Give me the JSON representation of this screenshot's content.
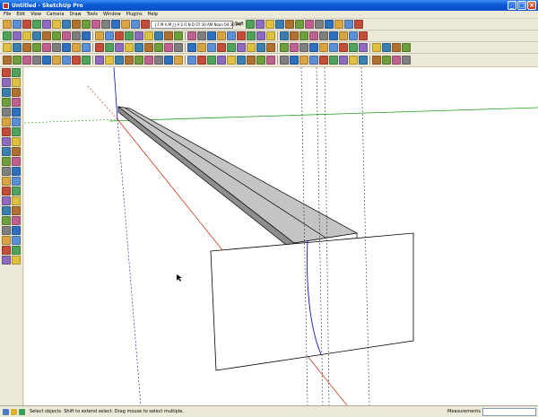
{
  "window": {
    "title": "Untitled - SketchUp Pro",
    "minimize": "_",
    "maximize": "□",
    "close": "×"
  },
  "menus": [
    "File",
    "Edit",
    "View",
    "Camera",
    "Draw",
    "Tools",
    "Window",
    "Plugins",
    "Help"
  ],
  "toolbar": {
    "shadow_time": "J F M A M J J A S O N D   07:30 AM   Noon   04:30 PM",
    "soft_label": "Soft"
  },
  "status": {
    "hint": "Select objects. Shift to extend select. Drag mouse to select multiple.",
    "measurements_label": "Measurements",
    "measurements_value": ""
  },
  "colors": {
    "red_axis": "#cc2200",
    "green_axis": "#18a018",
    "blue_axis": "#1010c0",
    "face_top": "#c4c4c4",
    "face_side": "#8e8e8e",
    "face_light": "#ffffff"
  },
  "icons": {
    "row1": [
      "new-icon",
      "open-icon",
      "save-icon",
      "print-icon",
      "cut-icon",
      "copy-icon",
      "paste-icon",
      "erase-icon",
      "undo-icon",
      "redo-icon",
      "select-icon",
      "eraser-icon",
      "paint-icon",
      "component-icon",
      "group-icon",
      "iso-view-icon",
      "top-view-icon",
      "front-view-icon",
      "right-view-icon",
      "back-view-icon",
      "left-view-icon",
      "x-ray-icon",
      "wireframe-icon",
      "hidden-line-icon",
      "shaded-icon",
      "shaded-texture-icon",
      "monochrome-icon"
    ],
    "row2": [
      "line-icon",
      "freehand-icon",
      "arc-icon",
      "rectangle-icon",
      "circle-icon",
      "polygon-icon",
      "pushpull-icon",
      "move-icon",
      "rotate-icon",
      "scale-icon",
      "followme-icon",
      "offset-icon",
      "tape-icon",
      "protractor-icon",
      "axes-icon",
      "dimension-icon",
      "text-icon",
      "3dtext-icon",
      "section-icon",
      "orbit-icon",
      "pan-icon",
      "zoom-icon",
      "zoom-window-icon",
      "zoom-extents-icon",
      "previous-icon",
      "walk-icon",
      "lookaround-icon",
      "position-camera-icon",
      "sandbox-icon",
      "smoove-icon",
      "stamp-icon",
      "drape-icon",
      "add-detail-icon",
      "flip-edge-icon",
      "layers-icon",
      "warehouse-icon"
    ],
    "row3": [
      "plugin-icon",
      "plugin-icon",
      "plugin-icon",
      "plugin-icon",
      "plugin-icon",
      "plugin-icon",
      "plugin-icon",
      "plugin-icon",
      "plugin-icon",
      "plugin-icon",
      "plugin-icon",
      "plugin-icon",
      "plugin-icon",
      "plugin-icon",
      "plugin-icon",
      "plugin-icon",
      "plugin-icon",
      "plugin-icon",
      "plugin-icon",
      "plugin-icon",
      "plugin-icon",
      "plugin-icon",
      "plugin-icon",
      "plugin-icon",
      "plugin-icon",
      "plugin-icon",
      "plugin-icon",
      "plugin-icon",
      "plugin-icon",
      "plugin-icon",
      "plugin-icon",
      "plugin-icon",
      "plugin-icon",
      "plugin-icon",
      "plugin-icon",
      "plugin-icon",
      "plugin-icon",
      "plugin-icon",
      "plugin-icon",
      "plugin-icon"
    ],
    "left": [
      "arrow-icon",
      "paint-bucket-icon",
      "rectangle-icon",
      "pencil-icon",
      "circle-icon",
      "arc-icon",
      "polygon-icon",
      "freehand-icon",
      "move-icon",
      "pushpull-icon",
      "rotate-icon",
      "followme-icon",
      "scale-icon",
      "offset-icon",
      "tape-icon",
      "dimension-icon",
      "protractor-icon",
      "text-icon",
      "axes-icon",
      "3dtext-icon",
      "orbit-icon",
      "pan-icon",
      "zoom-icon",
      "zoom-window-icon",
      "zoom-extents-icon",
      "previous-icon",
      "position-camera-icon",
      "lookaround-icon",
      "walk-icon",
      "section-icon",
      "plugin-icon",
      "plugin-icon",
      "plugin-icon",
      "plugin-icon",
      "plugin-icon",
      "plugin-icon",
      "plugin-icon",
      "plugin-icon",
      "plugin-icon",
      "plugin-icon"
    ]
  }
}
